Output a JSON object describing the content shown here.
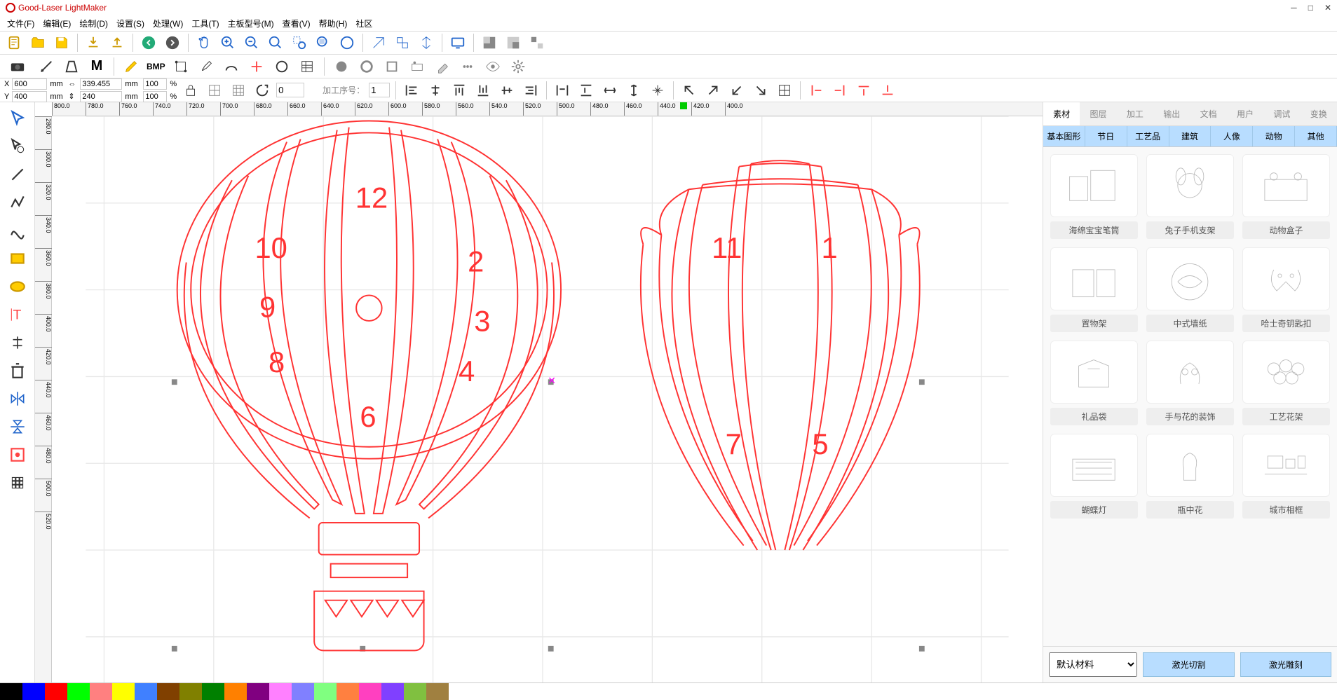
{
  "titlebar": {
    "title": "Good-Laser LightMaker"
  },
  "menu": [
    "文件(F)",
    "编辑(E)",
    "绘制(D)",
    "设置(S)",
    "处理(W)",
    "工具(T)",
    "主板型号(M)",
    "查看(V)",
    "帮助(H)",
    "社区"
  ],
  "coords": {
    "x_label": "X",
    "x_val": "600",
    "x_unit": "mm",
    "y_label": "Y",
    "y_val": "400",
    "y_unit": "mm",
    "w_val": "339.455",
    "w_unit": "mm",
    "w_pct": "100",
    "pct_unit": "%",
    "h_val": "240",
    "h_unit": "mm",
    "h_pct": "100",
    "rotate": "0",
    "seq_label": "加工序号：",
    "seq_val": "1"
  },
  "bmp_label": "BMP",
  "ruler_h": [
    "800.0",
    "780.0",
    "760.0",
    "740.0",
    "720.0",
    "700.0",
    "680.0",
    "660.0",
    "640.0",
    "620.0",
    "600.0",
    "580.0",
    "560.0",
    "540.0",
    "520.0",
    "500.0",
    "480.0",
    "460.0",
    "440.0",
    "420.0",
    "400.0"
  ],
  "ruler_v": [
    "280.0",
    "300.0",
    "320.0",
    "340.0",
    "360.0",
    "380.0",
    "400.0",
    "420.0",
    "440.0",
    "460.0",
    "480.0",
    "500.0",
    "520.0"
  ],
  "balloon_numbers": [
    "12",
    "10",
    "2",
    "9",
    "3",
    "8",
    "4",
    "6",
    "11",
    "1",
    "7",
    "5"
  ],
  "panel_tabs": [
    "素材",
    "图层",
    "加工",
    "输出",
    "文档",
    "用户",
    "调试",
    "变换"
  ],
  "cat_tabs": [
    "基本图形",
    "节日",
    "工艺品",
    "建筑",
    "人像",
    "动物",
    "其他"
  ],
  "gallery": [
    "海绵宝宝笔筒",
    "兔子手机支架",
    "动物盒子",
    "置物架",
    "中式墙纸",
    "哈士奇钥匙扣",
    "礼品袋",
    "手与花的装饰",
    "工艺花架",
    "蝴蝶灯",
    "瓶中花",
    "城市相框"
  ],
  "material_default": "默认材料",
  "btn_cut": "激光切割",
  "btn_engrave": "激光雕刻",
  "colors": [
    "#000000",
    "#0000ff",
    "#ff0000",
    "#00ff00",
    "#ff8080",
    "#ffff00",
    "#4080ff",
    "#804000",
    "#808000",
    "#008000",
    "#ff8000",
    "#800080",
    "#ff80ff",
    "#8080ff",
    "#80ff80",
    "#ff8040",
    "#ff40c0",
    "#8040ff",
    "#80c040",
    "#a08040"
  ]
}
